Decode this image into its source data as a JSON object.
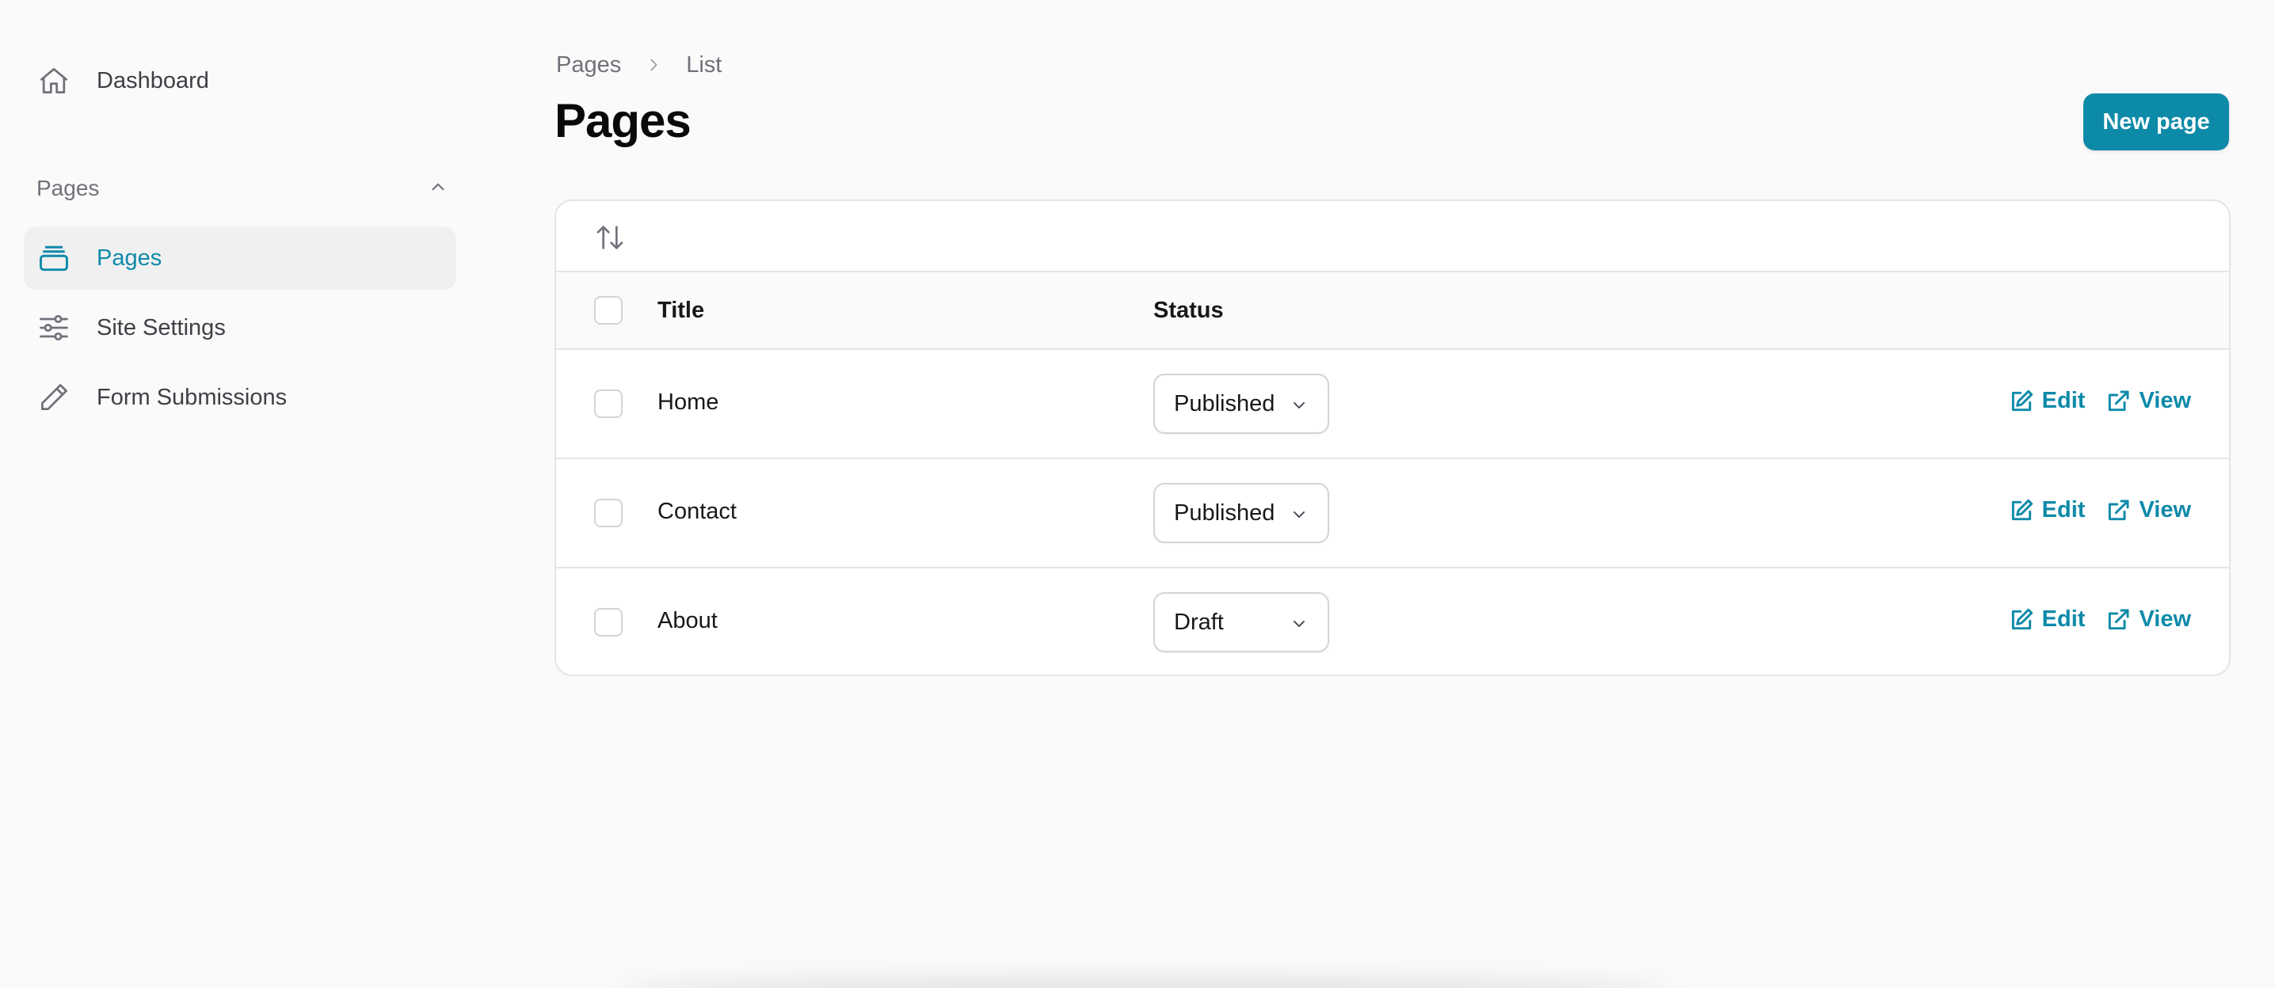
{
  "sidebar": {
    "dashboard": {
      "label": "Dashboard",
      "icon": "home-icon"
    },
    "group": {
      "label": "Pages",
      "icon": "chevron-up-icon"
    },
    "items": [
      {
        "label": "Pages",
        "icon": "rectangle-stack-icon",
        "active": true
      },
      {
        "label": "Site Settings",
        "icon": "adjustments-icon",
        "active": false
      },
      {
        "label": "Form Submissions",
        "icon": "pencil-icon",
        "active": false
      }
    ]
  },
  "breadcrumb": {
    "parent": "Pages",
    "current": "List"
  },
  "header": {
    "title": "Pages",
    "new_button": "New page"
  },
  "table": {
    "columns": {
      "title": "Title",
      "status": "Status"
    },
    "rows": [
      {
        "title": "Home",
        "status": "Published",
        "edit": "Edit",
        "view": "View"
      },
      {
        "title": "Contact",
        "status": "Published",
        "edit": "Edit",
        "view": "View"
      },
      {
        "title": "About",
        "status": "Draft",
        "edit": "Edit",
        "view": "View"
      }
    ]
  },
  "colors": {
    "accent": "#0e8aa9",
    "text": "#18181b",
    "muted": "#71717a",
    "border": "#e4e4e7"
  }
}
